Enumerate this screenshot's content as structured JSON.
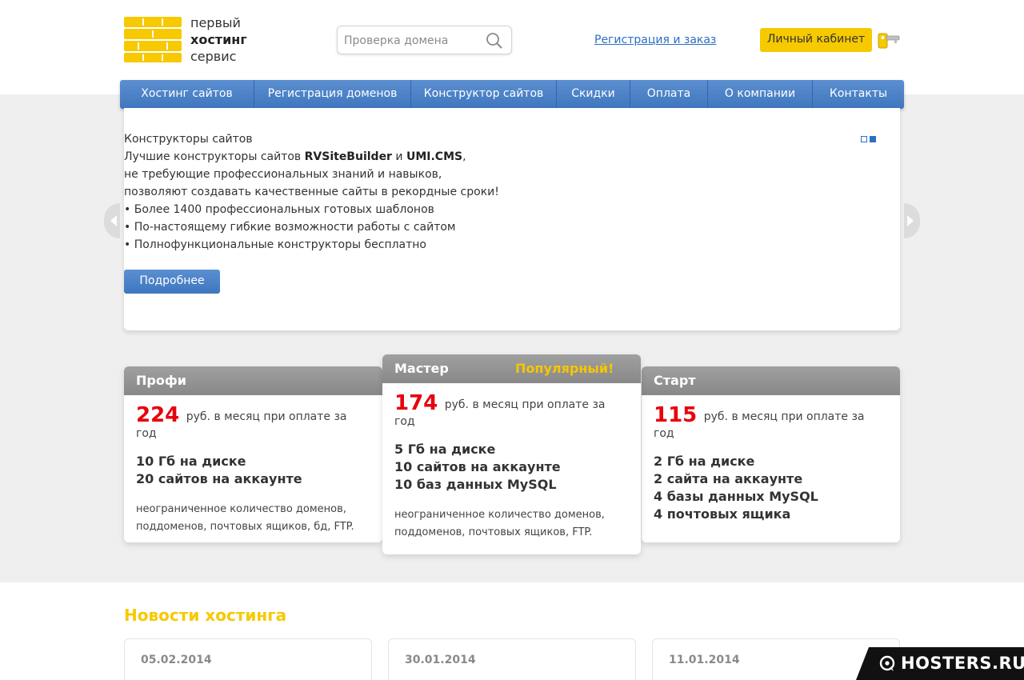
{
  "logo": {
    "line1": "первый",
    "line2": "хостинг",
    "line3": "сервис"
  },
  "search": {
    "placeholder": "Проверка домена"
  },
  "header": {
    "register_link": "Регистрация и заказ",
    "cabinet_button": "Личный кабинет"
  },
  "nav": {
    "items": [
      {
        "label": "Хостинг сайтов"
      },
      {
        "label": "Регистрация доменов"
      },
      {
        "label": "Конструктор сайтов"
      },
      {
        "label": "Скидки"
      },
      {
        "label": "Оплата"
      },
      {
        "label": "О компании"
      },
      {
        "label": "Контакты"
      }
    ]
  },
  "slider": {
    "heading": "Конструкторы сайтов",
    "line1_pre": "Лучшие конструкторы сайтов ",
    "line1_b1": "RVSiteBuilder",
    "line1_mid": " и ",
    "line1_b2": "UMI.CMS",
    "line1_post": ",",
    "line2": "не требующие профессиональных знаний и навыков,",
    "line3": "позволяют создавать качественные сайты в рекордные сроки!",
    "bullet1": "• Более 1400 профессиональных готовых шаблонов",
    "bullet2": "• По-настоящему гибкие возможности работы с сайтом",
    "bullet3": "• Полнофункциональные конструкторы бесплатно",
    "button": "Подробнее",
    "active_dot": 2
  },
  "plans": [
    {
      "name": "Профи",
      "price": "224",
      "price_text": "руб. в месяц при оплате за год",
      "features": [
        "10 Гб на диске",
        "20 сайтов на аккаунте"
      ],
      "extra": [
        "неограниченное количество доменов,",
        "поддоменов, почтовых ящиков, бд, FTP."
      ]
    },
    {
      "name": "Мастер",
      "badge": "Популярный!",
      "price": "174",
      "price_text": "руб. в месяц при оплате за год",
      "features": [
        "5 Гб на диске",
        "10 сайтов на аккаунте",
        "10 баз данных MySQL"
      ],
      "extra": [
        "неограниченное количество доменов,",
        "поддоменов, почтовых ящиков, FTP."
      ]
    },
    {
      "name": "Старт",
      "price": "115",
      "price_text": "руб. в месяц при оплате за год",
      "features": [
        "2 Гб на диске",
        "2 сайта на аккаунте",
        "4 базы данных MySQL",
        "4 почтовых ящика"
      ]
    }
  ],
  "news": {
    "title": "Новости хостинга",
    "items": [
      {
        "date": "05.02.2014"
      },
      {
        "date": "30.01.2014"
      },
      {
        "date": "11.01.2014"
      }
    ]
  },
  "watermark": {
    "text": "HOSTERS.RU"
  },
  "colors": {
    "brand_yellow": "#f6c900",
    "nav_blue": "#3f76be",
    "price_red": "#e8000d",
    "link_blue": "#2a70c2"
  }
}
